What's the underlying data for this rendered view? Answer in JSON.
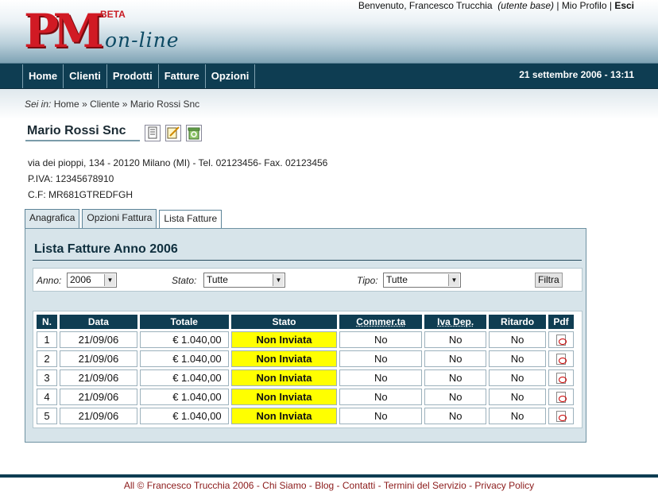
{
  "logo": {
    "pm": "PM",
    "beta": "BETA",
    "online": "on-line"
  },
  "userbar": {
    "welcome": "Benvenuto, Francesco Trucchia",
    "role": "(utente base)",
    "sep1": "|",
    "profile": "Mio Profilo",
    "sep2": "|",
    "exit": "Esci"
  },
  "nav": {
    "items": [
      "Home",
      "Clienti",
      "Prodotti",
      "Fatture",
      "Opzioni"
    ],
    "date": "21 settembre 2006 - 13:11"
  },
  "breadcrumb": {
    "label": "Sei in:",
    "items": [
      "Home",
      "Cliente",
      "Mario Rossi Snc"
    ],
    "sep": "»"
  },
  "client": {
    "name": "Mario Rossi Snc",
    "address": "via dei pioppi, 134 - 20120 Milano (MI) - Tel. 02123456- Fax. 02123456",
    "piva": "P.IVA: 12345678910",
    "cf": "C.F: MR681GTREDFGH",
    "icons": [
      "document-icon",
      "edit-icon",
      "recycle-icon"
    ]
  },
  "tabs": [
    "Anagrafica",
    "Opzioni Fattura",
    "Lista Fatture"
  ],
  "panel": {
    "title": "Lista Fatture Anno 2006"
  },
  "filter": {
    "anno_label": "Anno:",
    "anno_value": "2006",
    "stato_label": "Stato:",
    "stato_value": "Tutte",
    "tipo_label": "Tipo:",
    "tipo_value": "Tutte",
    "button": "Filtra"
  },
  "table": {
    "headers": [
      "N.",
      "Data",
      "Totale",
      "Stato",
      "Commer.ta",
      "Iva Dep.",
      "Ritardo",
      "Pdf"
    ],
    "rows": [
      {
        "n": "1",
        "data": "21/09/06",
        "totale": "€ 1.040,00",
        "stato": "Non Inviata",
        "commerta": "No",
        "iva": "No",
        "ritardo": "No"
      },
      {
        "n": "2",
        "data": "21/09/06",
        "totale": "€ 1.040,00",
        "stato": "Non Inviata",
        "commerta": "No",
        "iva": "No",
        "ritardo": "No"
      },
      {
        "n": "3",
        "data": "21/09/06",
        "totale": "€ 1.040,00",
        "stato": "Non Inviata",
        "commerta": "No",
        "iva": "No",
        "ritardo": "No"
      },
      {
        "n": "4",
        "data": "21/09/06",
        "totale": "€ 1.040,00",
        "stato": "Non Inviata",
        "commerta": "No",
        "iva": "No",
        "ritardo": "No"
      },
      {
        "n": "5",
        "data": "21/09/06",
        "totale": "€ 1.040,00",
        "stato": "Non Inviata",
        "commerta": "No",
        "iva": "No",
        "ritardo": "No"
      }
    ],
    "pdf_icon": "pdf-icon"
  },
  "footer": {
    "copy": "All © Francesco Trucchia 2006",
    "links": [
      "Chi Siamo",
      "Blog",
      "Contatti",
      "Termini del Servizio",
      "Privacy Policy"
    ],
    "sep": " - "
  },
  "colors": {
    "nav": "#0e3d52",
    "status_highlight": "#ffff00",
    "logo_red": "#d11a24"
  }
}
